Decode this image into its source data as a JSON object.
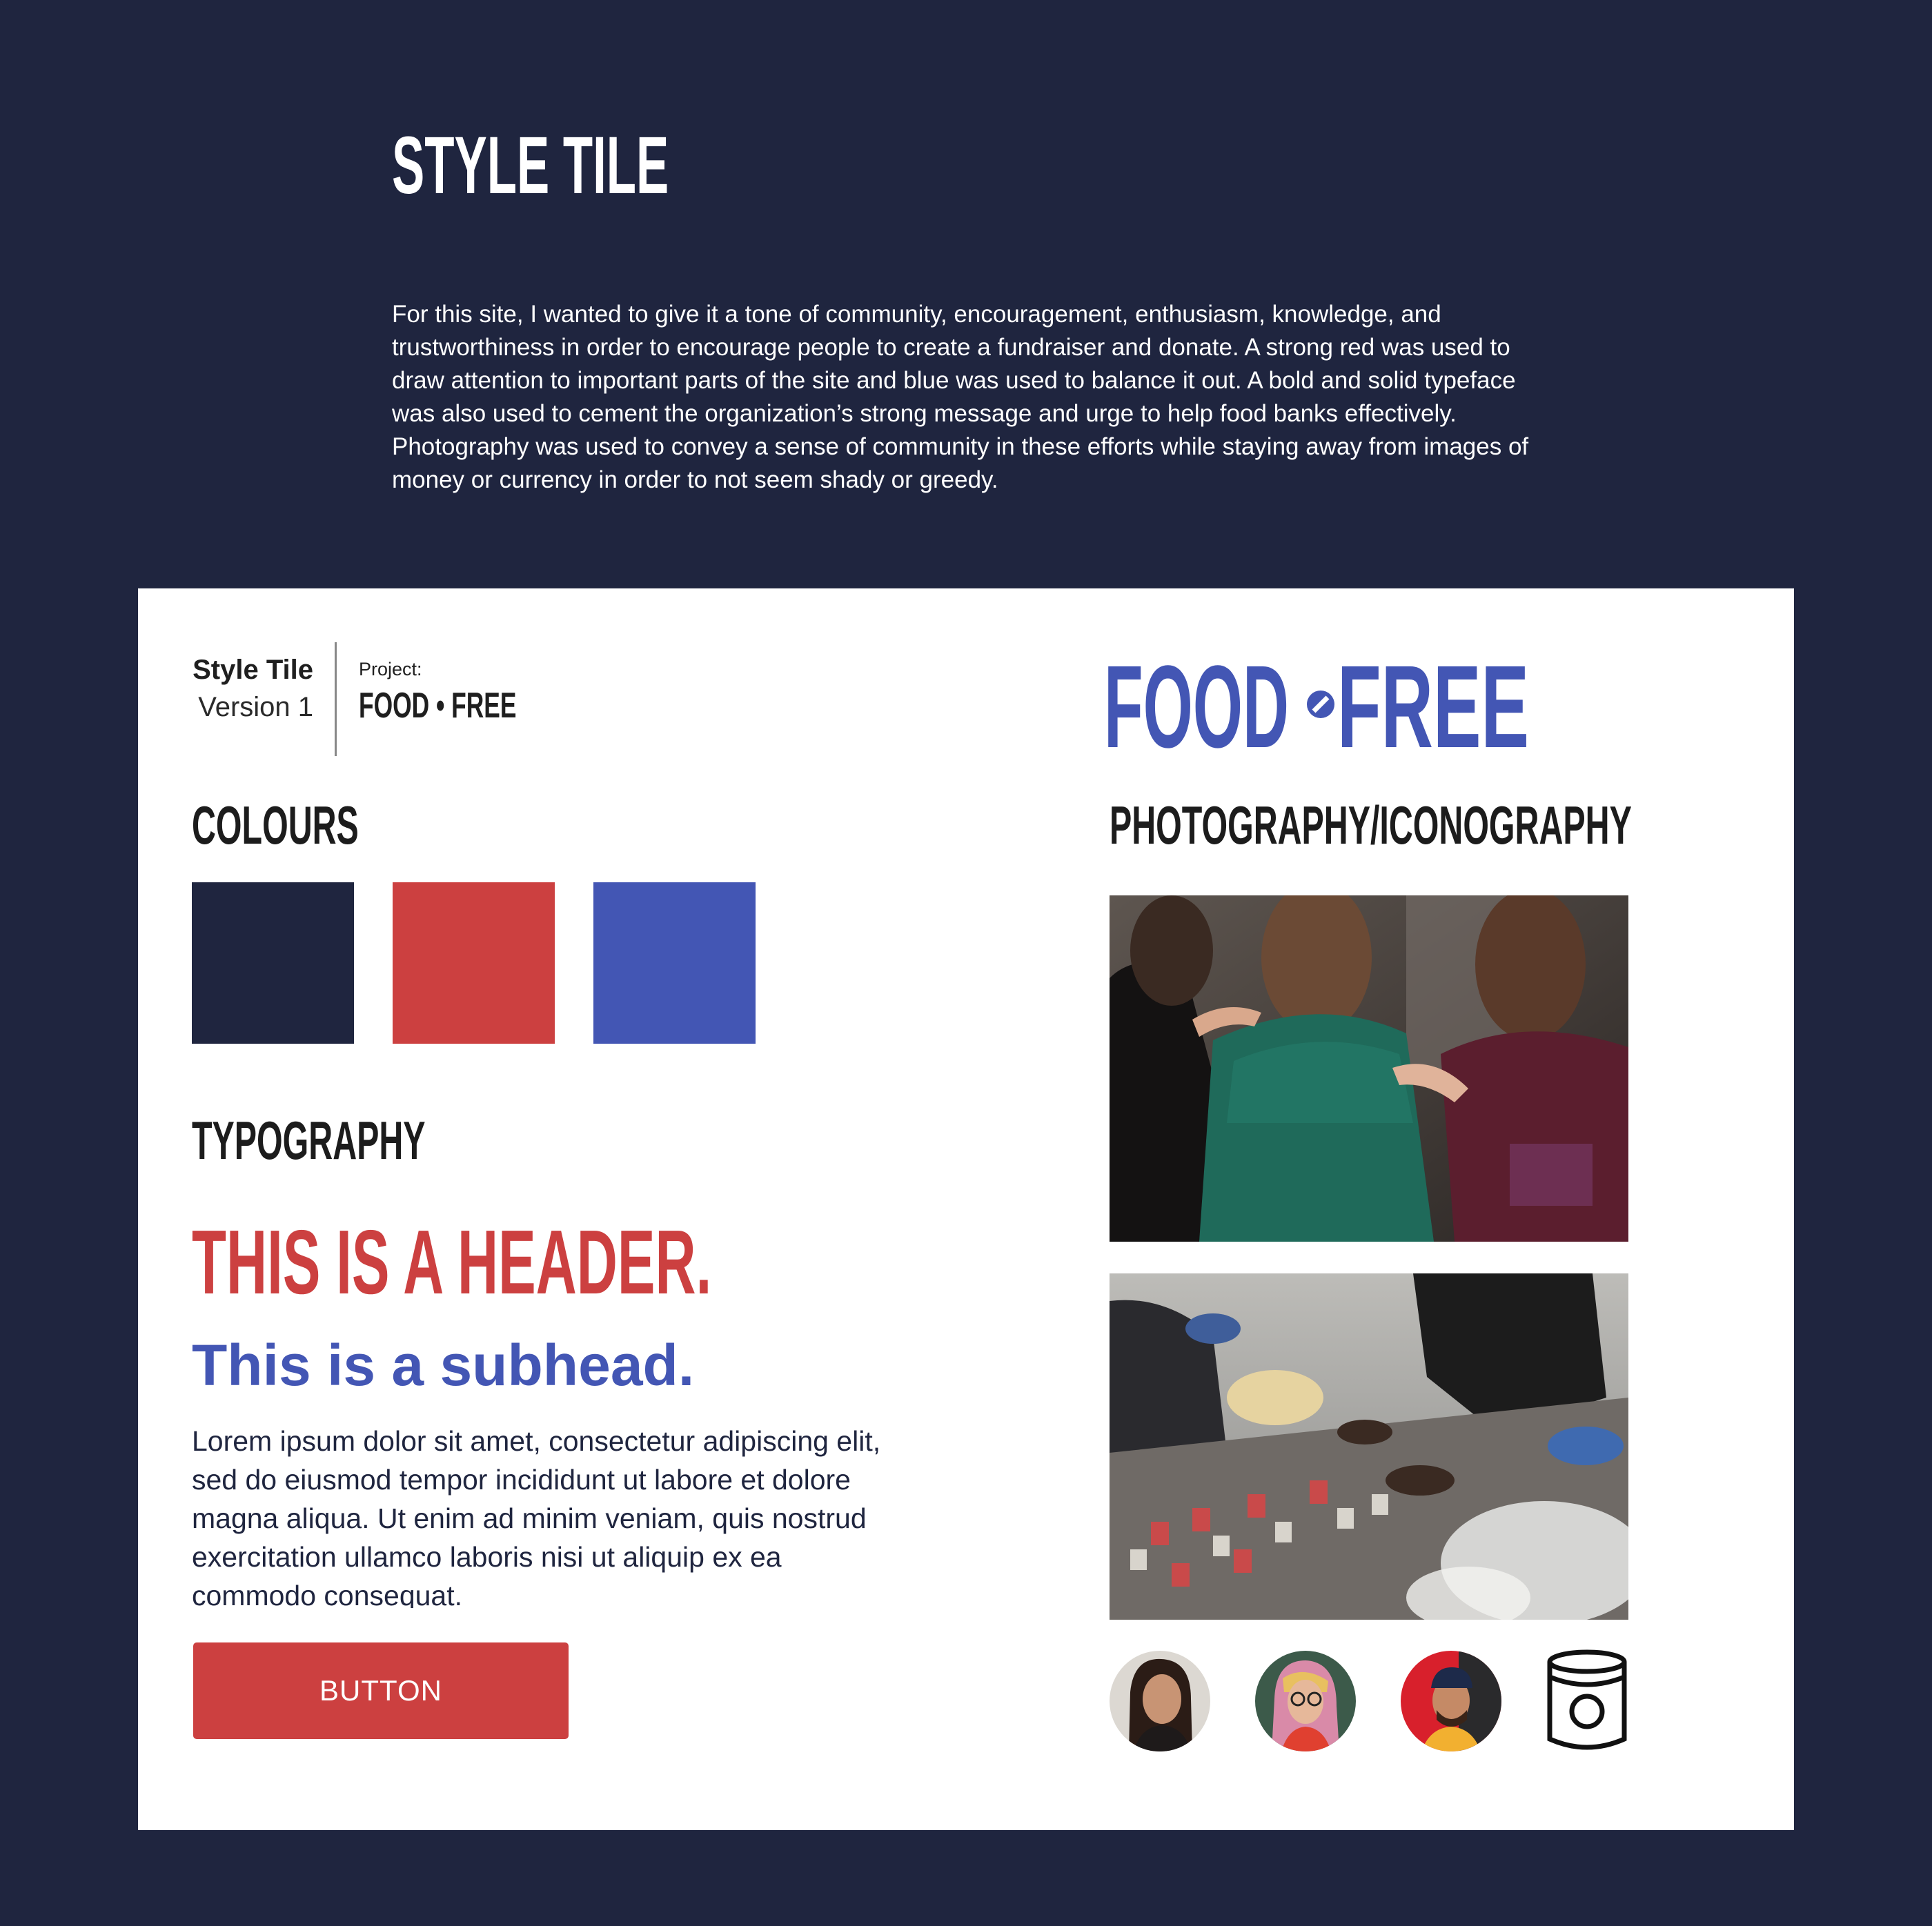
{
  "page": {
    "title": "STYLE TILE",
    "intro": "For this site, I wanted to give it a tone of community, encouragement, enthusiasm, knowledge, and trustworthiness in order to encourage people to create a fundraiser and donate. A strong red was used to draw attention to important parts of the site and blue was used to balance it out. A bold and solid typeface was also used to cement the organization’s strong message and urge to help food banks effectively. Photography was used to convey a sense of community in these efforts while staying away from images of money or currency in order to not seem shady or greedy."
  },
  "tile": {
    "label": "Style Tile",
    "version": "Version 1",
    "project_label": "Project:",
    "project_name": "FOOD • FREE"
  },
  "logo": {
    "left": "FOOD",
    "right": "FREE"
  },
  "sections": {
    "colours": "COLOURS",
    "typography": "TYPOGRAPHY",
    "photography": "PHOTOGRAPHY/ICONOGRAPHY"
  },
  "colors": {
    "navy": "#1f253f",
    "red": "#cc4040",
    "blue": "#4356b4"
  },
  "typography": {
    "header": "THIS IS A HEADER.",
    "subhead": "This is a subhead.",
    "body": "Lorem ipsum dolor sit amet, consectetur adipiscing elit, sed do eiusmod tempor incididunt ut labore et dolore magna aliqua. Ut enim ad minim veniam, quis nostrud exercitation ullamco laboris nisi ut aliquip ex ea commodo consequat.",
    "button": "BUTTON"
  },
  "icons": [
    "avatar",
    "avatar",
    "avatar",
    "canned-food-icon"
  ]
}
